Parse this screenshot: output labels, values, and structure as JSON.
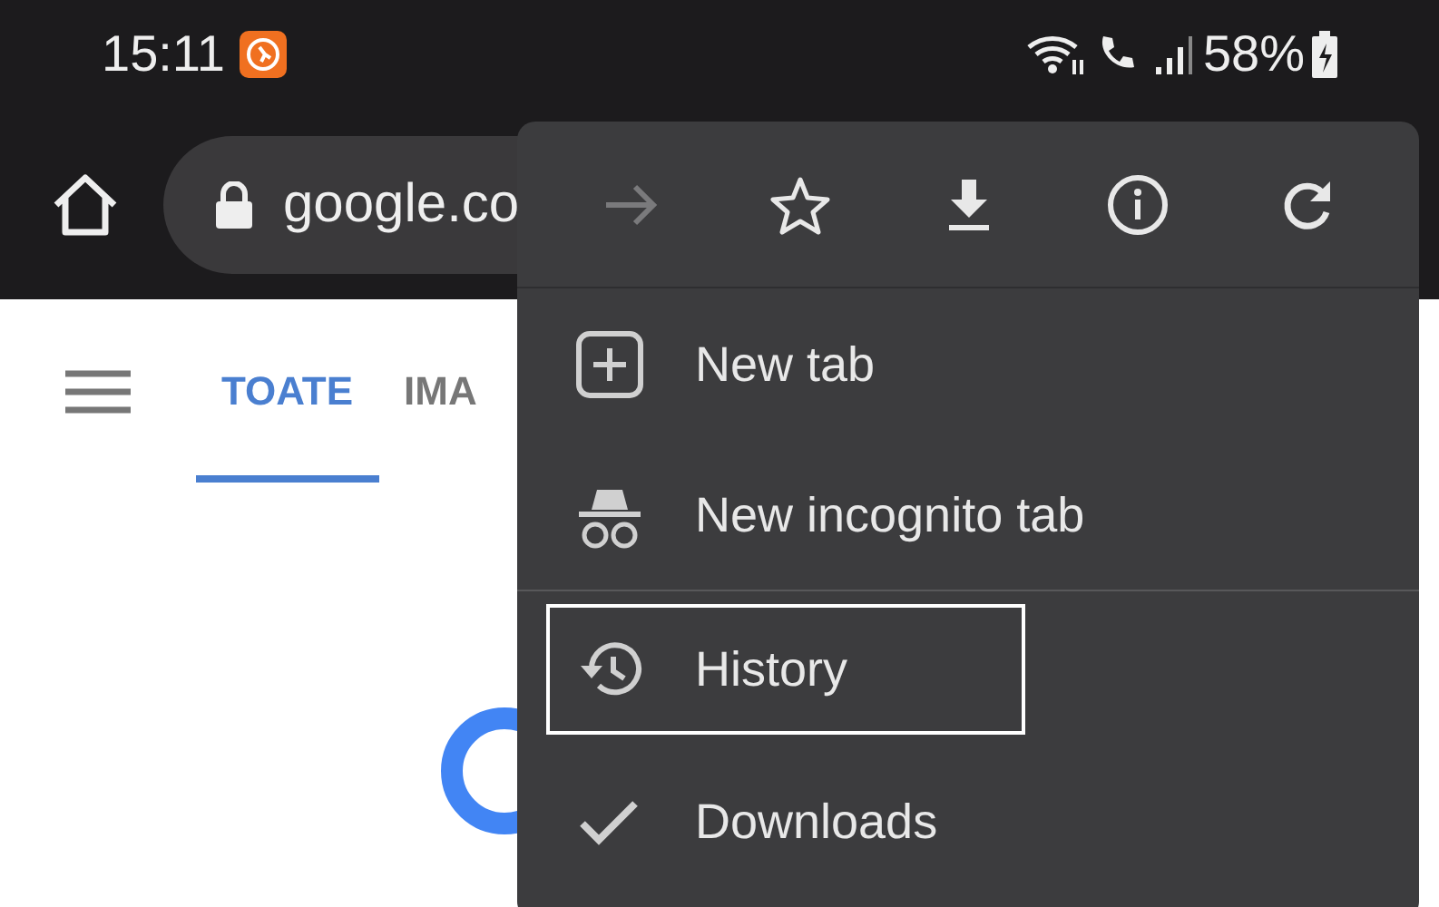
{
  "status_bar": {
    "time": "15:11",
    "battery": "58%"
  },
  "toolbar": {
    "url": "google.co"
  },
  "tabs": [
    {
      "label": "TOATE",
      "selected": true
    },
    {
      "label": "IMA",
      "selected": false
    }
  ],
  "menu": {
    "icon_row": [
      {
        "kind": "forward",
        "disabled": true
      },
      {
        "kind": "star",
        "disabled": false
      },
      {
        "kind": "download",
        "disabled": false
      },
      {
        "kind": "info",
        "disabled": false
      },
      {
        "kind": "refresh",
        "disabled": false
      }
    ],
    "items": [
      {
        "kind": "new-tab",
        "label": "New tab",
        "focused": false,
        "divider_after": false
      },
      {
        "kind": "incognito",
        "label": "New incognito tab",
        "focused": false,
        "divider_after": true
      },
      {
        "kind": "history",
        "label": "History",
        "focused": true,
        "divider_after": false
      },
      {
        "kind": "downloads",
        "label": "Downloads",
        "focused": false,
        "divider_after": false
      }
    ]
  }
}
